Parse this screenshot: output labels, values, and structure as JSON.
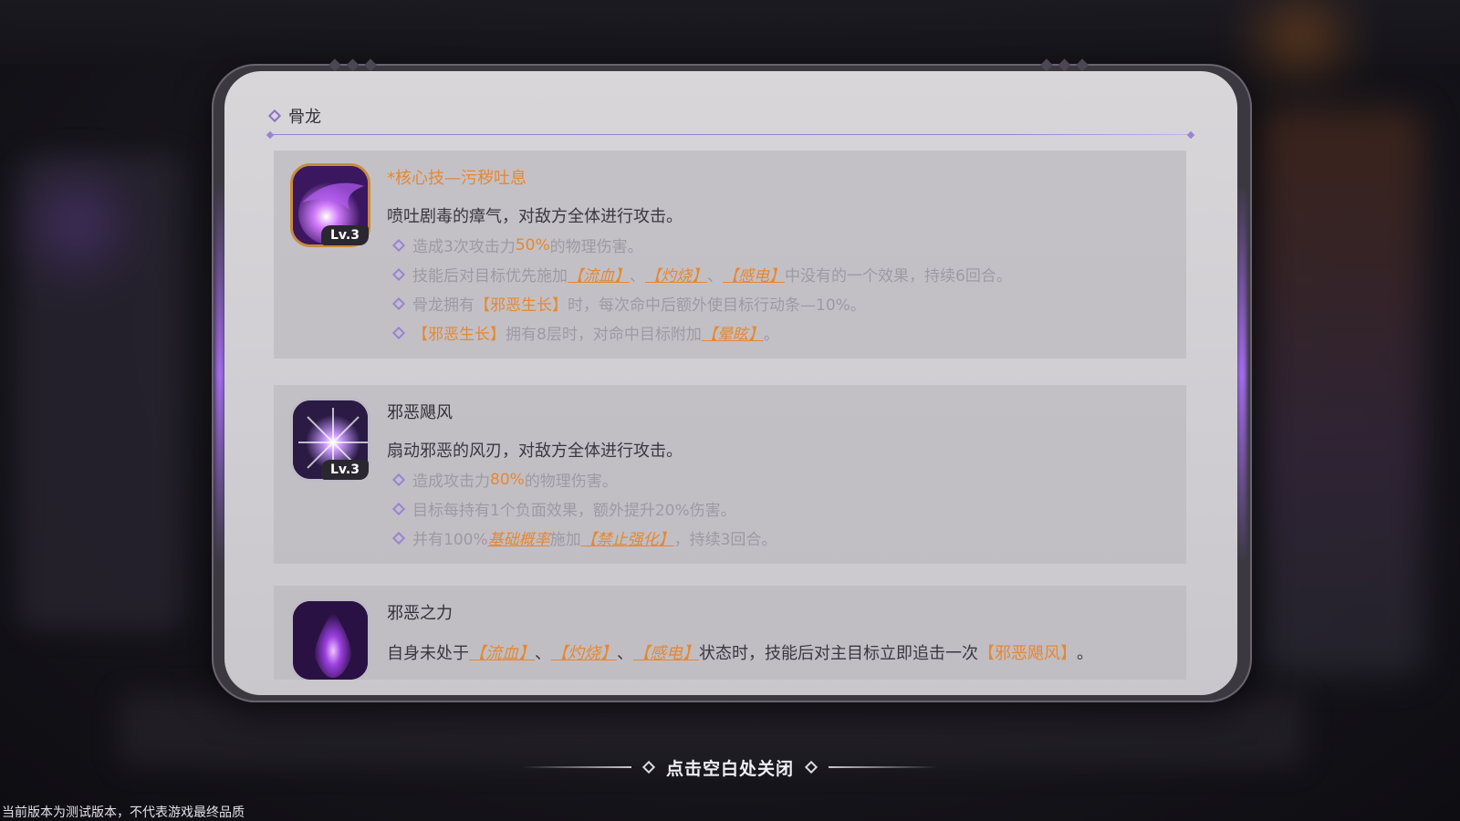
{
  "dialog": {
    "title": "骨龙",
    "close_hint": "点击空白处关闭"
  },
  "skills": [
    {
      "name": "*核心技—污秽吐息",
      "level": "Lv.3",
      "description": "喷吐剧毒的瘴气，对敌方全体进行攻击。",
      "bullets": {
        "b1": {
          "a": "造成3次攻击力",
          "b": "50%",
          "c": "的物理伤害。"
        },
        "b2": {
          "a": "技能后对目标优先施加",
          "t1": "【流血】",
          "s1": "、",
          "t2": "【灼烧】",
          "s2": "、",
          "t3": "【感电】",
          "c": "中没有的一个效果，持续6回合。"
        },
        "b3": {
          "a": "骨龙拥有",
          "t1": "【邪恶生长】",
          "c": "时，每次命中后额外使目标行动条—10%。"
        },
        "b4": {
          "t1": "【邪恶生长】",
          "a": "拥有8层时，对命中目标附加",
          "t2": "【晕眩】",
          "c": "。"
        }
      }
    },
    {
      "name": "邪恶飓风",
      "level": "Lv.3",
      "description": "扇动邪恶的风刃，对敌方全体进行攻击。",
      "bullets": {
        "b1": {
          "a": "造成攻击力",
          "b": "80%",
          "c": "的物理伤害。"
        },
        "b2": {
          "a": "目标每持有1个负面效果，额外提升20%伤害。"
        },
        "b3": {
          "a": "并有100%",
          "u": "基础概率",
          "m": "施加",
          "t1": "【禁止强化】",
          "c": "，持续3回合。"
        }
      }
    },
    {
      "name": "邪恶之力",
      "description": {
        "a": "自身未处于",
        "t1": "【流血】",
        "s1": "、",
        "t2": "【灼烧】",
        "s2": "、",
        "t3": "【感电】",
        "m": "状态时，技能后对主目标立即追击一次",
        "t4": "【邪恶飓风】",
        "c": "。"
      }
    }
  ],
  "footer": {
    "watermark": "当前版本为测试版本，不代表游戏最终品质"
  },
  "colors": {
    "accent_orange": "#e68732",
    "accent_purple": "#9b83d3",
    "panel_bg": "#d8d6d9"
  }
}
